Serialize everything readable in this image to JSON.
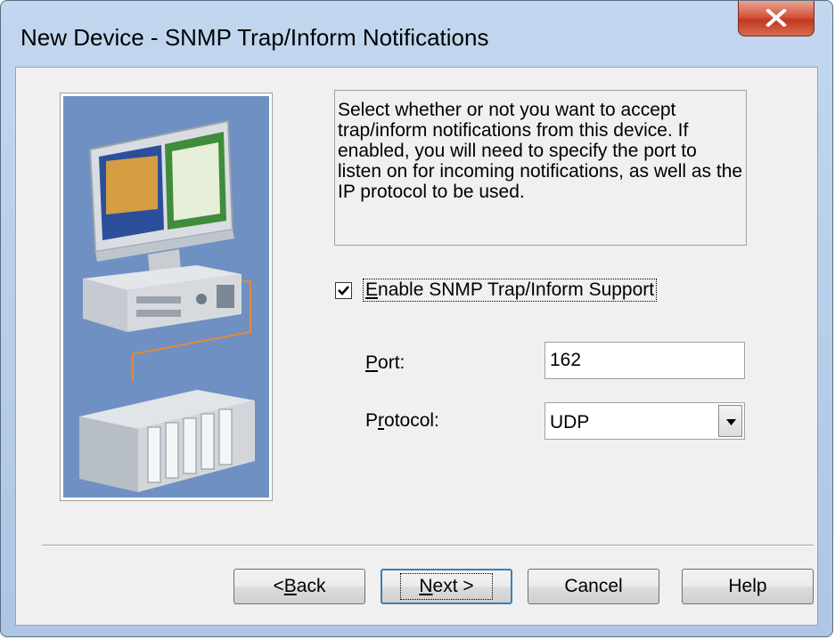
{
  "window": {
    "title": "New Device - SNMP Trap/Inform Notifications"
  },
  "description": "Select whether or not you want to accept trap/inform notifications from this device. If enabled, you will need to specify the port to listen on for incoming notifications, as well as the IP protocol to be used.",
  "enable_checkbox": {
    "checked": true,
    "label_mnemonic": "E",
    "label_rest": "nable SNMP Trap/Inform Support"
  },
  "port": {
    "label_mnemonic": "P",
    "label_rest": "ort:",
    "value": "162"
  },
  "protocol": {
    "label_pre": "P",
    "label_mnemonic": "r",
    "label_rest": "otocol:",
    "value": "UDP"
  },
  "buttons": {
    "back_pre": "< ",
    "back_mnemonic": "B",
    "back_rest": "ack",
    "next_mnemonic": "N",
    "next_rest": "ext >",
    "cancel": "Cancel",
    "help": "Help"
  },
  "icons": {
    "close": "close-icon",
    "check": "checkmark-icon",
    "dropdown": "chevron-down-icon"
  },
  "colors": {
    "image_background": "#6f90c2",
    "close_button": "#c0391f",
    "default_button_border": "#3c7fb1"
  }
}
